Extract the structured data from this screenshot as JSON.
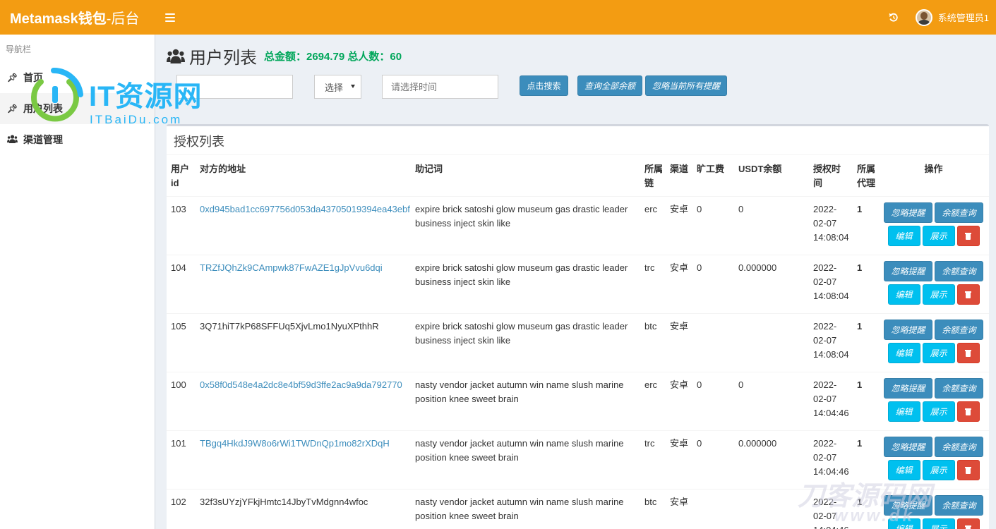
{
  "header": {
    "brand": "Metamask钱包",
    "brand_suffix": "-后台",
    "user_name": "系统管理员1"
  },
  "sidebar": {
    "header": "导航栏",
    "items": [
      {
        "label": "首页",
        "icon": "pin-icon"
      },
      {
        "label": "用户列表",
        "icon": "pin-icon"
      },
      {
        "label": "渠道管理",
        "icon": "users-icon"
      }
    ]
  },
  "page": {
    "title": "用户列表",
    "summary": "总金额：2694.79 总人数：60"
  },
  "search": {
    "address_placeholder": "",
    "select_value": "选择",
    "date_placeholder": "请选择时间",
    "search_button": "点击搜索",
    "query_all_button": "查询全部余额",
    "ignore_all_button": "忽略当前所有提醒"
  },
  "box": {
    "title": "授权列表"
  },
  "table": {
    "headers": [
      "用户id",
      "对方的地址",
      "助记词",
      "所属链",
      "渠道",
      "旷工费",
      "USDT余额",
      "授权时间",
      "所属代理",
      "操作"
    ],
    "rows": [
      {
        "id": "103",
        "address": "0xd945bad1cc697756d053da43705019394ea43ebf",
        "address_link": true,
        "mnemonic": "expire brick satoshi glow museum gas drastic leader business inject skin like",
        "chain": "erc",
        "channel": "安卓",
        "fee": "0",
        "usdt": "0",
        "time": "2022-02-07 14:08:04",
        "agent": "1"
      },
      {
        "id": "104",
        "address": "TRZfJQhZk9CAmpwk87FwAZE1gJpVvu6dqi",
        "address_link": true,
        "mnemonic": "expire brick satoshi glow museum gas drastic leader business inject skin like",
        "chain": "trc",
        "channel": "安卓",
        "fee": "0",
        "usdt": "0.000000",
        "time": "2022-02-07 14:08:04",
        "agent": "1"
      },
      {
        "id": "105",
        "address": "3Q71hiT7kP68SFFUq5XjvLmo1NyuXPthhR",
        "address_link": false,
        "mnemonic": "expire brick satoshi glow museum gas drastic leader business inject skin like",
        "chain": "btc",
        "channel": "安卓",
        "fee": "",
        "usdt": "",
        "time": "2022-02-07 14:08:04",
        "agent": "1"
      },
      {
        "id": "100",
        "address": "0x58f0d548e4a2dc8e4bf59d3ffe2ac9a9da792770",
        "address_link": true,
        "mnemonic": "nasty vendor jacket autumn win name slush marine position knee sweet brain",
        "chain": "erc",
        "channel": "安卓",
        "fee": "0",
        "usdt": "0",
        "time": "2022-02-07 14:04:46",
        "agent": "1"
      },
      {
        "id": "101",
        "address": "TBgq4HkdJ9W8o6rWi1TWDnQp1mo82rXDqH",
        "address_link": true,
        "mnemonic": "nasty vendor jacket autumn win name slush marine position knee sweet brain",
        "chain": "trc",
        "channel": "安卓",
        "fee": "0",
        "usdt": "0.000000",
        "time": "2022-02-07 14:04:46",
        "agent": "1"
      },
      {
        "id": "102",
        "address": "32f3sUYzjYFkjHmtc14JbyTvMdgnn4wfoc",
        "address_link": false,
        "mnemonic": "nasty vendor jacket autumn win name slush marine position knee sweet brain",
        "chain": "btc",
        "channel": "安卓",
        "fee": "",
        "usdt": "",
        "time": "2022-02-07 14:04:46",
        "agent": "1"
      }
    ],
    "actions": {
      "ignore": "忽略提醒",
      "balance": "余额查询",
      "edit": "编辑",
      "show": "展示"
    }
  },
  "watermarks": {
    "logo_text": "IT资源网",
    "logo_sub": "ITBaiDu.com",
    "bottom_text": "刀客源码网",
    "bottom_sub": "www.dk"
  },
  "colors": {
    "topbar": "#f39c12",
    "primary": "#3c8dbc",
    "info": "#00c0ef",
    "danger": "#dd4b39",
    "success": "#00a65a"
  }
}
